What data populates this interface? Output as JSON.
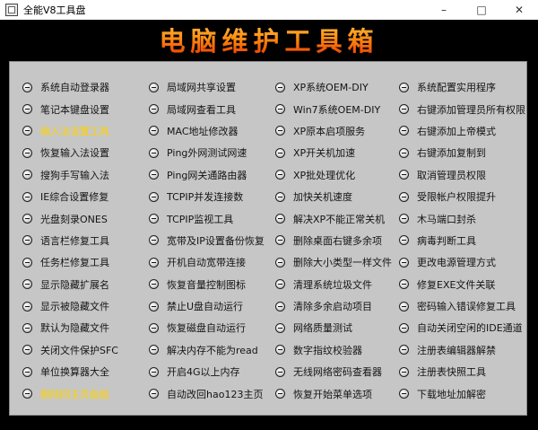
{
  "window": {
    "title": "全能V8工具盘",
    "minimize_icon": "minimize-icon",
    "maximize_icon": "maximize-icon",
    "close_icon": "close-icon"
  },
  "banner": {
    "text": "电脑维护工具箱"
  },
  "colors": {
    "selected_text": "#ffd200",
    "panel_bg": "#c6c6c6",
    "window_bg": "#000000"
  },
  "tools": [
    [
      "系统自动登录器",
      "局域网共享设置",
      "XP系统OEM-DIY",
      "系统配置实用程序"
    ],
    [
      "笔记本键盘设置",
      "局域网查看工具",
      "Win7系统OEM-DIY",
      "右键添加管理员所有权限"
    ],
    [
      "输入法设置工具",
      "MAC地址修改器",
      "XP原本启项服务",
      "右键添加上帝模式"
    ],
    [
      "恢复输入法设置",
      "Ping外网测试网速",
      "XP开关机加速",
      "右键添加复制到"
    ],
    [
      "搜狗手写输入法",
      "Ping网关通路由器",
      "XP批处理优化",
      "取消管理员权限"
    ],
    [
      "IE综合设置修复",
      "TCPIP并发连接数",
      "加快关机速度",
      "受限帐户权限提升"
    ],
    [
      "光盘刻录ONES",
      "TCPIP监视工具",
      "解决XP不能正常关机",
      "木马端口封杀"
    ],
    [
      "语言栏修复工具",
      "宽带及IP设置备份恢复",
      "删除桌面右键多余项",
      "病毒判断工具"
    ],
    [
      "任务栏修复工具",
      "开机自动宽带连接",
      "删除大小类型一样文件",
      "更改电源管理方式"
    ],
    [
      "显示隐藏扩展名",
      "恢复音量控制图标",
      "清理系统垃圾文件",
      "修复EXE文件关联"
    ],
    [
      "显示被隐藏文件",
      "禁止U盘自动运行",
      "清除多余启动项目",
      "密码输入错误修复工具"
    ],
    [
      "默认为隐藏文件",
      "恢复磁盘自动运行",
      "网络质量测试",
      "自动关闭空闲的IDE通道"
    ],
    [
      "关闭文件保护SFC",
      "解决内存不能为read",
      "数字指纹校验器",
      "注册表编辑器解禁"
    ],
    [
      "单位换算器大全",
      "开启4G以上内存",
      "无线网络密码查看器",
      "注册表快照工具"
    ],
    [
      "删除回主页画面",
      "自动改回hao123主页",
      "恢复开始菜单选项",
      "下载地址加解密"
    ]
  ],
  "item_icon": "circle-minus-icon"
}
